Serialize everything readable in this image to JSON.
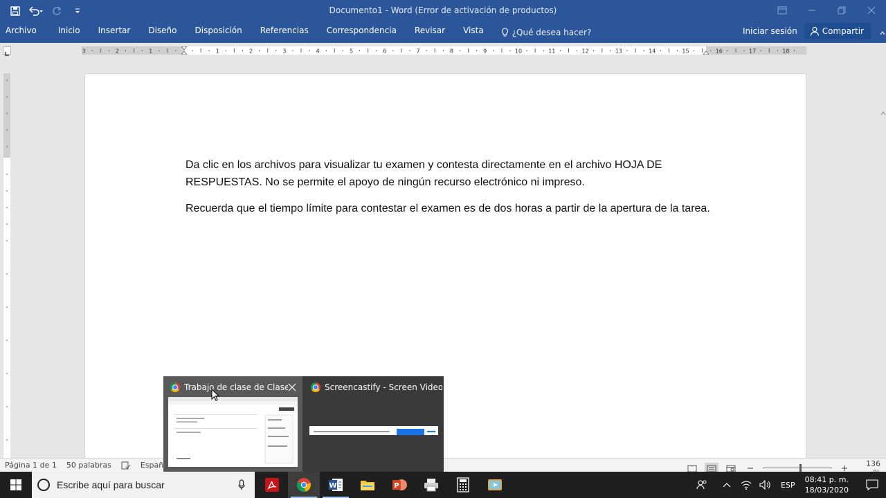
{
  "window": {
    "title": "Documento1 - Word (Error de activación de productos)"
  },
  "ribbon": {
    "tabs": [
      "Archivo",
      "Inicio",
      "Insertar",
      "Diseño",
      "Disposición",
      "Referencias",
      "Correspondencia",
      "Revisar",
      "Vista"
    ],
    "tell_me": "¿Qué desea hacer?",
    "sign_in": "Iniciar sesión",
    "share": "Compartir"
  },
  "ruler": {
    "labels": [
      "3",
      "2",
      "1",
      "1",
      "2",
      "3",
      "4",
      "5",
      "6",
      "7",
      "8",
      "9",
      "10",
      "11",
      "12",
      "13",
      "14",
      "15",
      "16",
      "17",
      "18"
    ]
  },
  "document": {
    "paragraphs": [
      "Da clic en los archivos para visualizar tu examen y contesta directamente en el archivo HOJA DE RESPUESTAS. No se permite el apoyo de ningún recurso electrónico ni impreso.",
      "Recuerda que el tiempo límite para contestar el examen es de dos horas a partir de la apertura de la tarea."
    ]
  },
  "statusbar": {
    "page": "Página 1 de 1",
    "words": "50 palabras",
    "language": "Español",
    "zoom": "136 %",
    "zoom_level_percent": 136
  },
  "thumbnails": [
    {
      "title": "Trabajo de clase de Clase ...",
      "icon": "chrome-icon"
    },
    {
      "title": "Screencastify - Screen Video Re...",
      "icon": "chrome-icon"
    }
  ],
  "taskbar": {
    "search_placeholder": "Escribe aquí para buscar",
    "language": "ESP",
    "time": "08:41 p. m.",
    "date": "18/03/2020"
  },
  "colors": {
    "word_blue": "#2b579a",
    "taskbar": "#1f1f1f",
    "thumbnail_bg": "#3a3a3a"
  }
}
